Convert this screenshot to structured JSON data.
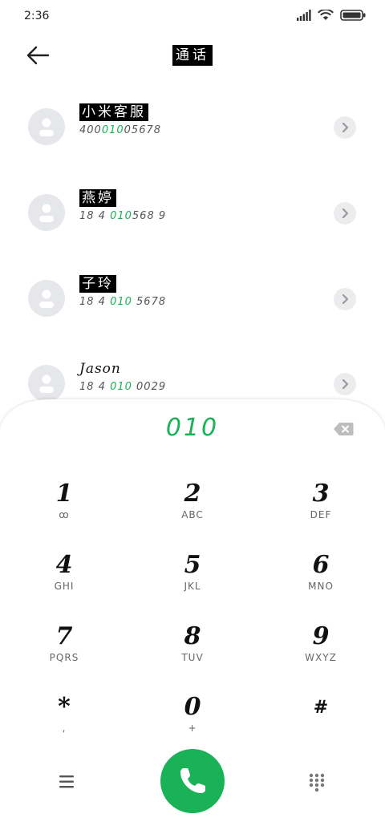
{
  "status": {
    "time": "2:36"
  },
  "header": {
    "title": "通话"
  },
  "contacts": [
    {
      "name": "小米客服",
      "num_pre": "400",
      "num_hl": "010",
      "num_post": "05678"
    },
    {
      "name": "燕婷",
      "num_pre": "18 4 ",
      "num_hl": "010",
      "num_post": "568 9"
    },
    {
      "name": "子玲",
      "num_pre": "18 4 ",
      "num_hl": "010",
      "num_post": " 5678"
    },
    {
      "name": "Jason",
      "num_pre": "18 4 ",
      "num_hl": "010",
      "num_post": " 0029"
    }
  ],
  "dialer": {
    "input": "010",
    "keys": [
      {
        "digit": "1",
        "letters": "ꝏ"
      },
      {
        "digit": "2",
        "letters": "ABC"
      },
      {
        "digit": "3",
        "letters": "DEF"
      },
      {
        "digit": "4",
        "letters": "GHI"
      },
      {
        "digit": "5",
        "letters": "JKL"
      },
      {
        "digit": "6",
        "letters": "MNO"
      },
      {
        "digit": "7",
        "letters": "PQRS"
      },
      {
        "digit": "8",
        "letters": "TUV"
      },
      {
        "digit": "9",
        "letters": "WXYZ"
      },
      {
        "digit": "*",
        "letters": ","
      },
      {
        "digit": "0",
        "letters": "+"
      },
      {
        "digit": "#",
        "letters": ""
      }
    ]
  },
  "colors": {
    "accent": "#1ab256",
    "avatar_bg": "#e6e7ea"
  },
  "icons": [
    "back-arrow-icon",
    "signal-icon",
    "wifi-icon",
    "battery-icon",
    "chevron-right-icon",
    "delete-backspace-icon",
    "menu-icon",
    "phone-icon",
    "dialpad-icon",
    "voicemail-icon"
  ]
}
